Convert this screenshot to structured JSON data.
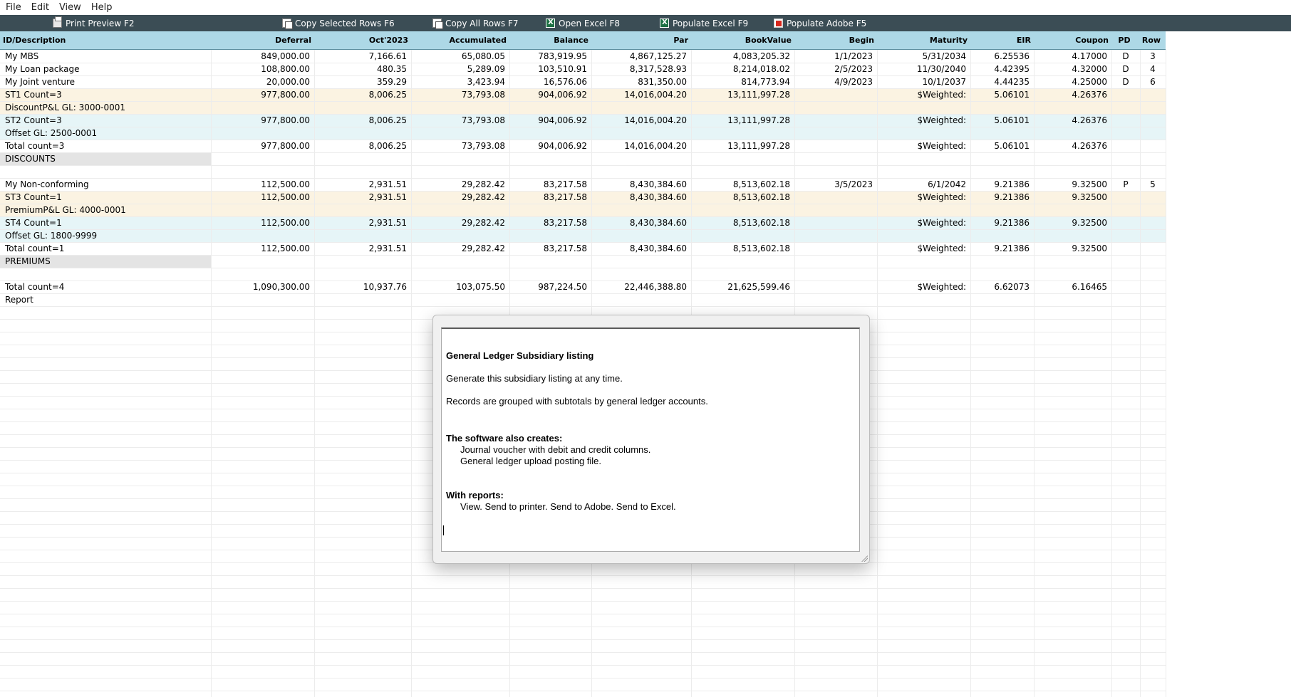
{
  "menu": [
    "File",
    "Edit",
    "View",
    "Help"
  ],
  "toolbar": [
    {
      "label": "Print Preview  F2",
      "icon": "print-icon"
    },
    {
      "label": "Copy Selected Rows  F6",
      "icon": "copy-icon"
    },
    {
      "label": "Copy All Rows  F7",
      "icon": "copy-icon"
    },
    {
      "label": "Open Excel  F8",
      "icon": "excel-icon"
    },
    {
      "label": "Populate Excel  F9",
      "icon": "excel-icon"
    },
    {
      "label": "Populate Adobe  F5",
      "icon": "adobe-pdf-icon"
    }
  ],
  "columns": [
    "ID/Description",
    "Deferral",
    "Oct'2023",
    "Accumulated",
    "Balance",
    "Par",
    "BookValue",
    "Begin",
    "Maturity",
    "EIR",
    "Coupon",
    "PD",
    "Row"
  ],
  "rows": [
    {
      "type": "data",
      "cells": [
        "My MBS",
        "849,000.00",
        "7,166.61",
        "65,080.05",
        "783,919.95",
        "4,867,125.27",
        "4,083,205.32",
        "1/1/2023",
        "5/31/2034",
        "6.25536",
        "4.17000",
        "D",
        "3"
      ]
    },
    {
      "type": "data",
      "cells": [
        "My Loan package",
        "108,800.00",
        "480.35",
        "5,289.09",
        "103,510.91",
        "8,317,528.93",
        "8,214,018.02",
        "2/5/2023",
        "11/30/2040",
        "4.42395",
        "4.32000",
        "D",
        "4"
      ]
    },
    {
      "type": "data",
      "cells": [
        "My Joint venture",
        "20,000.00",
        "359.29",
        "3,423.94",
        "16,576.06",
        "831,350.00",
        "814,773.94",
        "4/9/2023",
        "10/1/2037",
        "4.44235",
        "4.25000",
        "D",
        "6"
      ]
    },
    {
      "type": "st-sum",
      "cells": [
        "ST1 Count=3",
        "977,800.00",
        "8,006.25",
        "73,793.08",
        "904,006.92",
        "14,016,004.20",
        "13,111,997.28",
        "",
        "$Weighted:",
        "5.06101",
        "4.26376",
        "",
        ""
      ]
    },
    {
      "type": "st-sum",
      "cells": [
        "DiscountP&L GL: 3000-0001",
        "",
        "",
        "",
        "",
        "",
        "",
        "",
        "",
        "",
        "",
        "",
        ""
      ]
    },
    {
      "type": "st-off",
      "cells": [
        "ST2 Count=3",
        "977,800.00",
        "8,006.25",
        "73,793.08",
        "904,006.92",
        "14,016,004.20",
        "13,111,997.28",
        "",
        "$Weighted:",
        "5.06101",
        "4.26376",
        "",
        ""
      ]
    },
    {
      "type": "st-off",
      "cells": [
        "Offset GL: 2500-0001",
        "",
        "",
        "",
        "",
        "",
        "",
        "",
        "",
        "",
        "",
        "",
        ""
      ]
    },
    {
      "type": "data",
      "cells": [
        "Total count=3",
        "977,800.00",
        "8,006.25",
        "73,793.08",
        "904,006.92",
        "14,016,004.20",
        "13,111,997.28",
        "",
        "$Weighted:",
        "5.06101",
        "4.26376",
        "",
        ""
      ]
    },
    {
      "type": "group",
      "cells": [
        "DISCOUNTS",
        "",
        "",
        "",
        "",
        "",
        "",
        "",
        "",
        "",
        "",
        "",
        ""
      ]
    },
    {
      "type": "blank",
      "cells": [
        "",
        "",
        "",
        "",
        "",
        "",
        "",
        "",
        "",
        "",
        "",
        "",
        ""
      ]
    },
    {
      "type": "data",
      "cells": [
        "My Non-conforming",
        "112,500.00",
        "2,931.51",
        "29,282.42",
        "83,217.58",
        "8,430,384.60",
        "8,513,602.18",
        "3/5/2023",
        "6/1/2042",
        "9.21386",
        "9.32500",
        "P",
        "5"
      ]
    },
    {
      "type": "st-sum",
      "cells": [
        "ST3 Count=1",
        "112,500.00",
        "2,931.51",
        "29,282.42",
        "83,217.58",
        "8,430,384.60",
        "8,513,602.18",
        "",
        "$Weighted:",
        "9.21386",
        "9.32500",
        "",
        ""
      ]
    },
    {
      "type": "st-sum",
      "cells": [
        "PremiumP&L GL: 4000-0001",
        "",
        "",
        "",
        "",
        "",
        "",
        "",
        "",
        "",
        "",
        "",
        ""
      ]
    },
    {
      "type": "st-off",
      "cells": [
        "ST4 Count=1",
        "112,500.00",
        "2,931.51",
        "29,282.42",
        "83,217.58",
        "8,430,384.60",
        "8,513,602.18",
        "",
        "$Weighted:",
        "9.21386",
        "9.32500",
        "",
        ""
      ]
    },
    {
      "type": "st-off",
      "cells": [
        "Offset GL: 1800-9999",
        "",
        "",
        "",
        "",
        "",
        "",
        "",
        "",
        "",
        "",
        "",
        ""
      ]
    },
    {
      "type": "data",
      "cells": [
        "Total count=1",
        "112,500.00",
        "2,931.51",
        "29,282.42",
        "83,217.58",
        "8,430,384.60",
        "8,513,602.18",
        "",
        "$Weighted:",
        "9.21386",
        "9.32500",
        "",
        ""
      ]
    },
    {
      "type": "group",
      "cells": [
        "PREMIUMS",
        "",
        "",
        "",
        "",
        "",
        "",
        "",
        "",
        "",
        "",
        "",
        ""
      ]
    },
    {
      "type": "blank",
      "cells": [
        "",
        "",
        "",
        "",
        "",
        "",
        "",
        "",
        "",
        "",
        "",
        "",
        ""
      ]
    },
    {
      "type": "data",
      "cells": [
        "Total count=4",
        "1,090,300.00",
        "10,937.76",
        "103,075.50",
        "987,224.50",
        "22,446,388.80",
        "21,625,599.46",
        "",
        "$Weighted:",
        "6.62073",
        "6.16465",
        "",
        ""
      ]
    },
    {
      "type": "data",
      "cells": [
        "Report",
        "",
        "",
        "",
        "",
        "",
        "",
        "",
        "",
        "",
        "",
        "",
        ""
      ]
    }
  ],
  "dialog": {
    "lines": [
      {
        "text": "General Ledger Subsidiary listing",
        "style": "b"
      },
      {
        "text": "Generate this subsidiary listing at any time.",
        "style": ""
      },
      {
        "text": "Records are grouped with subtotals by general ledger accounts.",
        "style": ""
      },
      {
        "text": "The software also creates:",
        "style": "b"
      },
      {
        "text": "Journal voucher with debit and credit columns.",
        "style": "ind"
      },
      {
        "text": "General ledger upload posting file.",
        "style": "ind"
      },
      {
        "text": "With reports:",
        "style": "b"
      },
      {
        "text": "View.  Send to printer.  Send to Adobe.  Send to Excel.",
        "style": "ind"
      }
    ]
  }
}
